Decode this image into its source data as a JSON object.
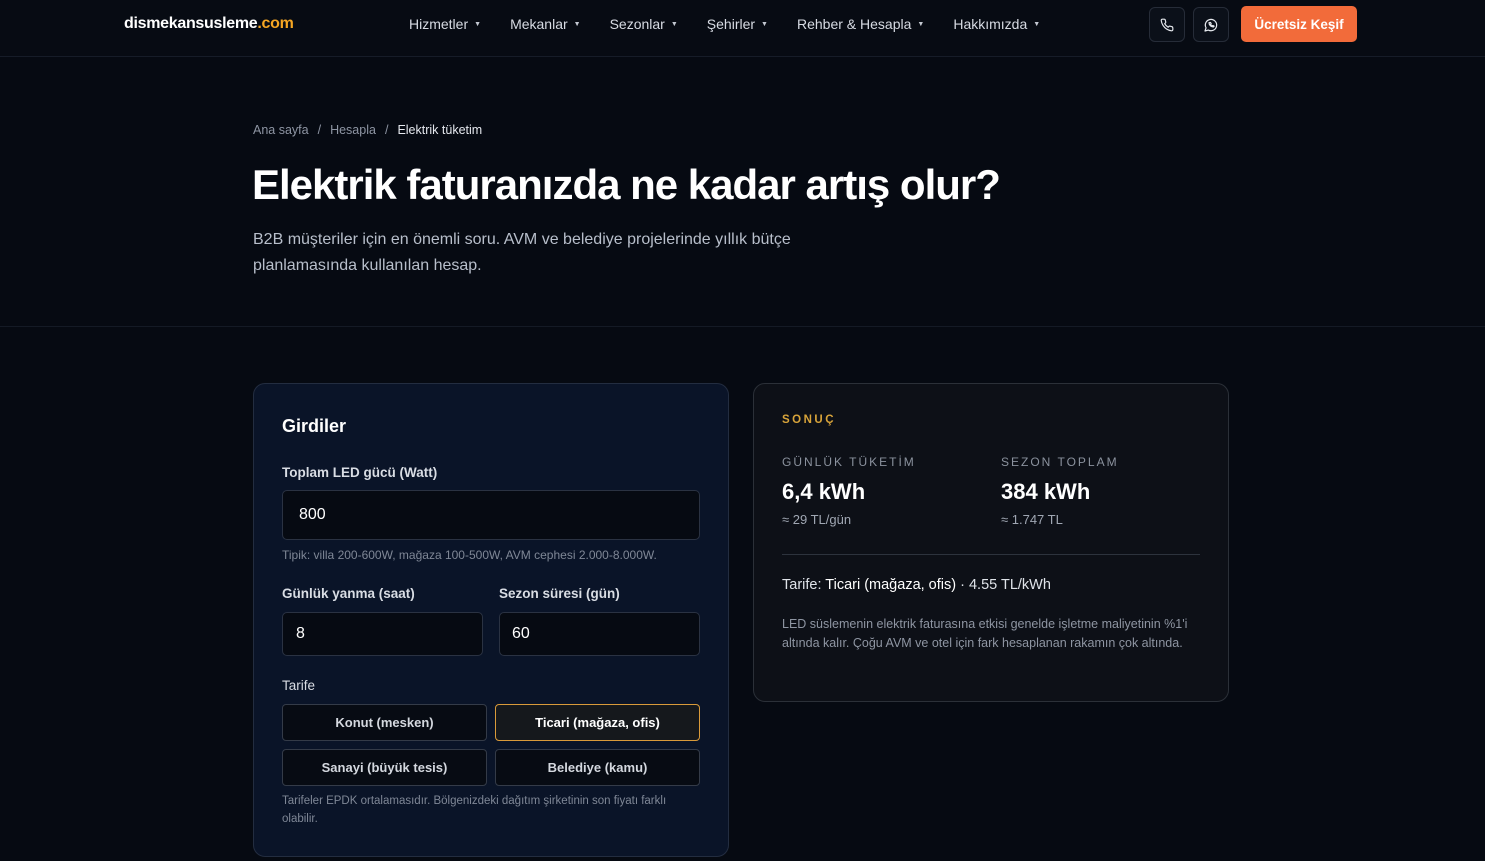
{
  "header": {
    "logo_main": "dismekansusleme",
    "logo_tld": ".com",
    "nav": [
      {
        "label": "Hizmetler"
      },
      {
        "label": "Mekanlar"
      },
      {
        "label": "Sezonlar"
      },
      {
        "label": "Şehirler"
      },
      {
        "label": "Rehber & Hesapla"
      },
      {
        "label": "Hakkımızda"
      }
    ],
    "phone_icon": "phone-icon",
    "whatsapp_icon": "whatsapp-icon",
    "cta_label": "Ücretsiz Keşif"
  },
  "breadcrumb": {
    "home": "Ana sayfa",
    "sep": "/",
    "section": "Hesapla",
    "current": "Elektrik tüketim"
  },
  "hero": {
    "title": "Elektrik faturanızda ne kadar artış olur?",
    "lead": "B2B müşteriler için en önemli soru. AVM ve belediye projelerinde yıllık bütçe planlamasında kullanılan hesap."
  },
  "inputs": {
    "title": "Girdiler",
    "power_label": "Toplam LED gücü (Watt)",
    "power_value": "800",
    "power_hint": "Tipik: villa 200-600W, mağaza 100-500W, AVM cephesi 2.000-8.000W.",
    "hours_label": "Günlük yanma (saat)",
    "hours_value": "8",
    "days_label": "Sezon süresi (gün)",
    "days_value": "60",
    "tariff_label": "Tarife",
    "tariffs": [
      {
        "label": "Konut (mesken)"
      },
      {
        "label": "Ticari (mağaza, ofis)"
      },
      {
        "label": "Sanayi (büyük tesis)"
      },
      {
        "label": "Belediye (kamu)"
      }
    ],
    "tariff_note": "Tarifeler EPDK ortalamasıdır. Bölgenizdeki dağıtım şirketinin son fiyatı farklı olabilir."
  },
  "result": {
    "eyebrow": "SONUÇ",
    "daily_label": "GÜNLÜK TÜKETİM",
    "daily_value": "6,4 kWh",
    "daily_sub": "≈ 29 TL/gün",
    "season_label": "SEZON TOPLAM",
    "season_value": "384 kWh",
    "season_sub": "≈ 1.747 TL",
    "tariff_prefix": "Tarife:",
    "tariff_name": "Ticari (mağaza, ofis)",
    "tariff_rate": "· 4.55 TL/kWh",
    "note": "LED süslemenin elektrik faturasına etkisi genelde işletme maliyetinin %1'i altında kalır. Çoğu AVM ve otel için fark hesaplanan rakamın çok altında."
  },
  "colors": {
    "accent": "#f26b3a",
    "gold": "#d8a43a",
    "background": "#060a12"
  }
}
